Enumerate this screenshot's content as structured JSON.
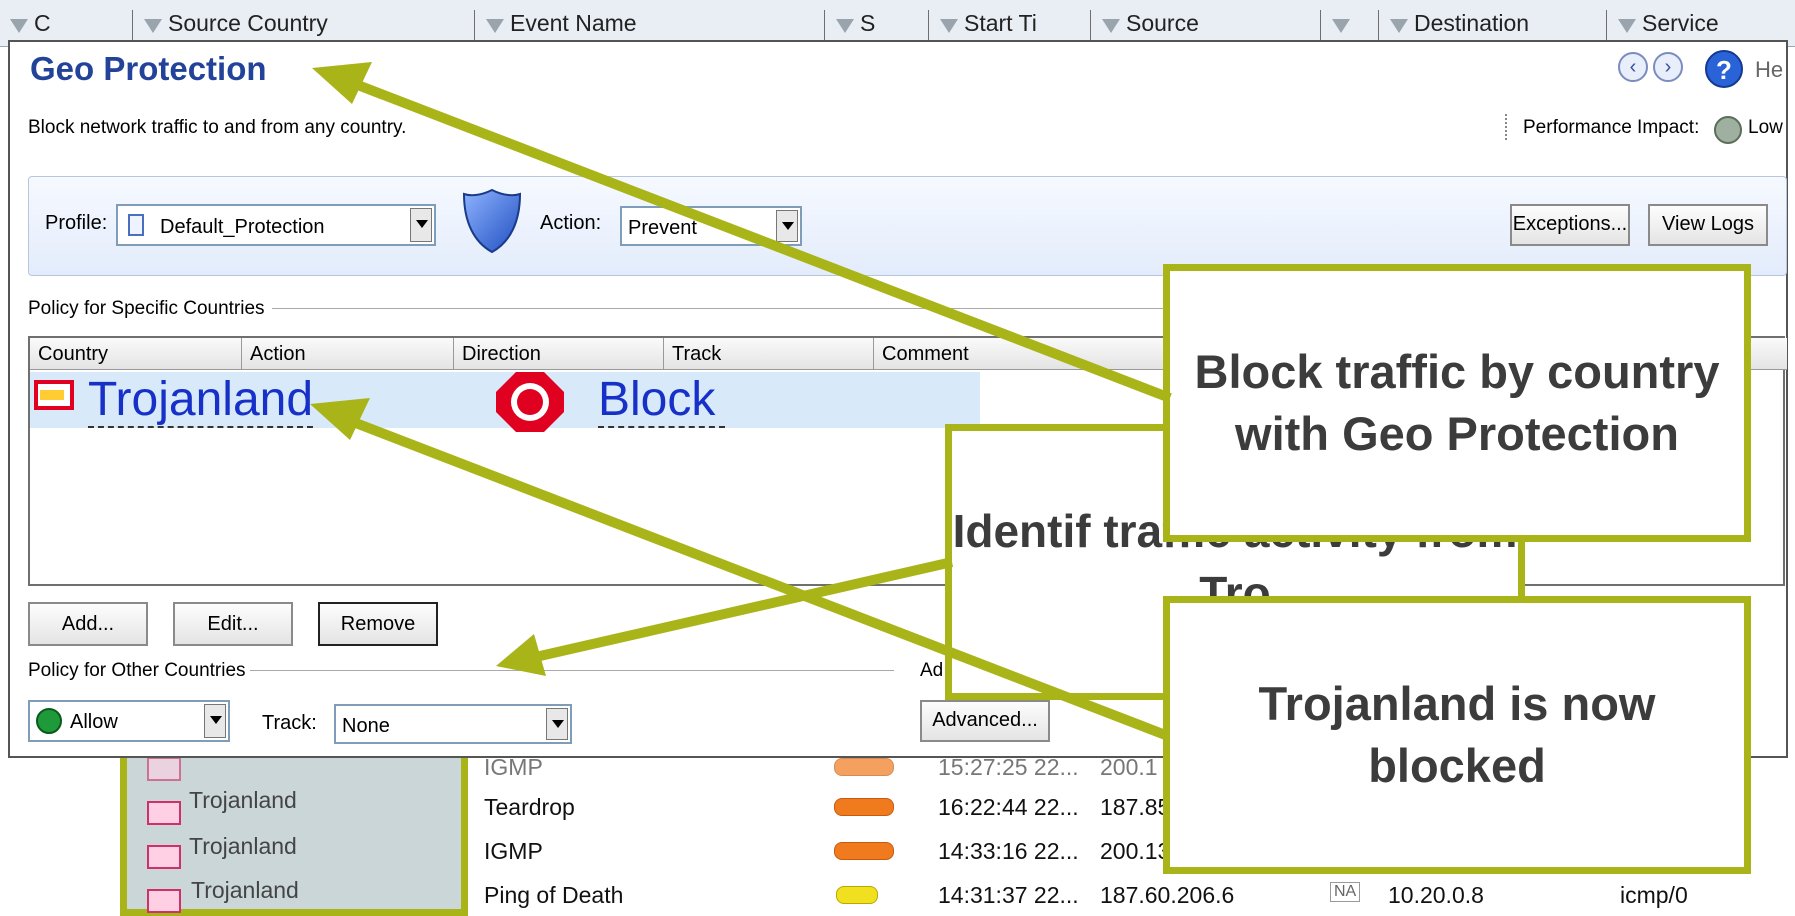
{
  "log_header": {
    "columns": [
      "C",
      "Source Country",
      "Event Name",
      "S",
      "Start Ti",
      "Source",
      "",
      "Destination",
      "Service"
    ]
  },
  "log_rows": [
    {
      "country": "",
      "event": "IGMP",
      "time": "15:27:25 22...",
      "source": "200.1",
      "sev": "orange"
    },
    {
      "country": "Trojanland",
      "event": "Teardrop",
      "time": "16:22:44 22...",
      "source": "187.85",
      "sev": "orange"
    },
    {
      "country": "Trojanland",
      "event": "IGMP",
      "time": "14:33:16 22...",
      "source": "200.13",
      "sev": "orange"
    },
    {
      "country": "Trojanland",
      "event": "Ping of Death",
      "time": "14:31:37 22...",
      "source": "187.60.206.6",
      "na": "NA",
      "destination": "10.20.0.8",
      "service": "icmp/0",
      "sev": "yellow"
    }
  ],
  "dialog": {
    "title": "Geo Protection",
    "description": "Block network traffic to and from any country.",
    "help_label": "He",
    "performance_label": "Performance Impact:",
    "performance_value": "Low",
    "profile_label": "Profile:",
    "profile_value": "Default_Protection",
    "action_label": "Action:",
    "action_value": "Prevent",
    "exceptions_button": "Exceptions...",
    "view_logs_button": "View Logs",
    "specific_section": "Policy for Specific Countries",
    "grid_columns": [
      "Country",
      "Action",
      "Direction",
      "Track",
      "Comment"
    ],
    "grid_row": {
      "country": "Trojanland",
      "action": "Block"
    },
    "add_button": "Add...",
    "edit_button": "Edit...",
    "remove_button": "Remove",
    "other_section": "Policy for Other Countries",
    "other_action": "Allow",
    "track_label": "Track:",
    "track_value": "None",
    "advanced_fragment": "Ad",
    "advanced_button": "Advanced..."
  },
  "callouts": {
    "geo": "Block traffic by country with Geo Protection",
    "identify": "Identif traffic activity from Tro",
    "blocked": "Trojanland is now blocked"
  },
  "colors": {
    "accent": "#a9b418",
    "title_blue": "#23439a",
    "block_red": "#e00020"
  }
}
